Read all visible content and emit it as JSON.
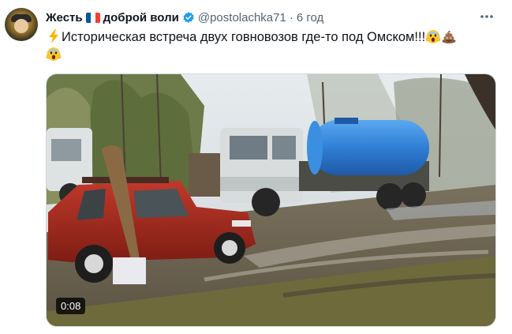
{
  "tweet": {
    "author_name": "Жесть",
    "author_name_suffix": "доброй воли",
    "handle": "@postolachka71",
    "separator": "·",
    "time": "6 год",
    "more_icon": "more-horizontal-icon",
    "text": "Историческая встреча двух говновозов где-то под Омском!!!",
    "video_duration": "0:08"
  },
  "colors": {
    "text": "#0f1419",
    "secondary": "#536471",
    "verified": "#1d9bf0",
    "border": "#cfd9de",
    "flag": [
      "#0055a4",
      "#ffffff",
      "#ef4135"
    ]
  }
}
